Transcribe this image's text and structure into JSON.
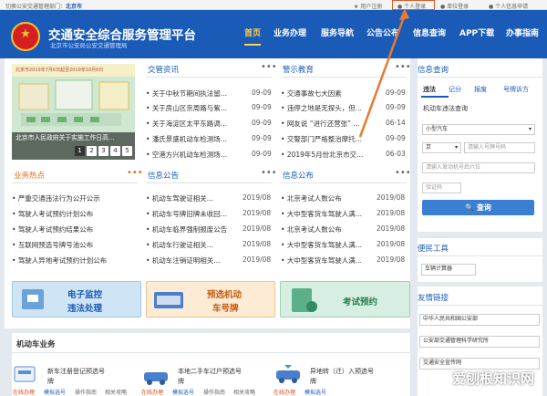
{
  "topbar": {
    "left_prefix": "切换公安交通管理部门：",
    "region": "北京市",
    "register": "用户注册",
    "login": "个人登录",
    "org_login": "单位登录",
    "personal_apply": "个人信息申请"
  },
  "header": {
    "title": "交通安全综合服务管理平台",
    "subtitle": "北京市公安局公安交通管理局",
    "nav": [
      "首页",
      "业务办理",
      "服务导航",
      "公告公布",
      "信息查询",
      "APP下载",
      "办事指南"
    ]
  },
  "carousel": {
    "top_text": "北京市2019年7月6日起至2019年10月6日",
    "caption": "北京市人民政府关于实施工作日高...",
    "pages": [
      "1",
      "2",
      "3",
      "4",
      "5"
    ]
  },
  "traffic_news": {
    "title": "交管资讯",
    "items": [
      {
        "text": "关于中秋节期间执法留...",
        "date": "09-09"
      },
      {
        "text": "关于房山区京周路与紫...",
        "date": "09-09"
      },
      {
        "text": "关于海淀区太平东路调...",
        "date": "09-09"
      },
      {
        "text": "潘氏景盛机动车检测场...",
        "date": "09-09"
      },
      {
        "text": "空港方兴机动车检测场...",
        "date": "09-09"
      }
    ]
  },
  "warning": {
    "title": "警示教育",
    "items": [
      {
        "text": "交通事故七大因素",
        "date": "09-09"
      },
      {
        "text": "违停之地是无探头，但...",
        "date": "09-09"
      },
      {
        "text": "网友说 “进行还营张” ...",
        "date": "06-14"
      },
      {
        "text": "交警部门严格整治摩托...",
        "date": "09-09"
      },
      {
        "text": "2019年5月份北京市交...",
        "date": "06-03"
      }
    ]
  },
  "hot": {
    "title": "业务热点",
    "items": [
      "严重交通违法行为公开公示",
      "驾驶人考试预约计划公布",
      "驾驶人考试预约结果公布",
      "互联网预选号牌号池公布",
      "驾驶人异地考试预约计划公布"
    ]
  },
  "notice": {
    "title": "信息公告",
    "items": [
      {
        "text": "机动车驾驶证相关...",
        "date": "2019/08"
      },
      {
        "text": "机动车号牌旧牌未收回...",
        "date": "2019/08"
      },
      {
        "text": "机动车临界强制报废公告",
        "date": "2019/08"
      },
      {
        "text": "机动车行驶证相关...",
        "date": "2019/08"
      },
      {
        "text": "机动车注销证明相关...",
        "date": "2019/08"
      }
    ]
  },
  "publicity": {
    "title": "信息公布",
    "items": [
      {
        "text": "北京考试人数公布",
        "date": "2019/08"
      },
      {
        "text": "大中型客货车驾驶人满...",
        "date": "2019/08"
      },
      {
        "text": "北京考试人数公布",
        "date": "2019/08"
      },
      {
        "text": "大中型客货车驾驶人满...",
        "date": "2019/08"
      },
      {
        "text": "大中型客货车驾驶人满...",
        "date": "2019/08"
      }
    ]
  },
  "banners": {
    "e_monitor_1": "电子监控",
    "e_monitor_2": "违法处理",
    "plate_1": "预选机动",
    "plate_2": "车号牌",
    "exam": "考试预约"
  },
  "vehicle": {
    "title": "机动车业务",
    "items": [
      {
        "title_1": "新车注册登记预选号",
        "title_2": "牌"
      },
      {
        "title_1": "本地二手车过户预选号",
        "title_2": "牌"
      },
      {
        "title_1": "异地转（迁）入预选号",
        "title_2": "牌"
      }
    ],
    "links": [
      "在线办理",
      "模拟选号",
      "操作指南",
      "相关攻略"
    ]
  },
  "query": {
    "title": "信息查询",
    "tabs": [
      "违法",
      "记分",
      "报废",
      "号牌诉方"
    ],
    "label": "机动车违法查询",
    "vehicle_type": "小型汽车",
    "plate_prefix": "京",
    "plate_placeholder": "请输入号牌号码",
    "engine_placeholder": "请输入发动机号后六位",
    "captcha_placeholder": "验证码",
    "submit": "查询"
  },
  "tools": {
    "title": "便民工具",
    "item": "车辆计算器"
  },
  "links": {
    "title": "友情链接",
    "items": [
      "中华人民共和国公安部",
      "公安部交通管理科学研究所",
      "交通安全宣传网"
    ]
  },
  "watermark": "爱刨根知识网",
  "colors": {
    "brand": "#1a5bb8",
    "accent": "#e06b1f",
    "active_nav": "#ffd04d"
  }
}
